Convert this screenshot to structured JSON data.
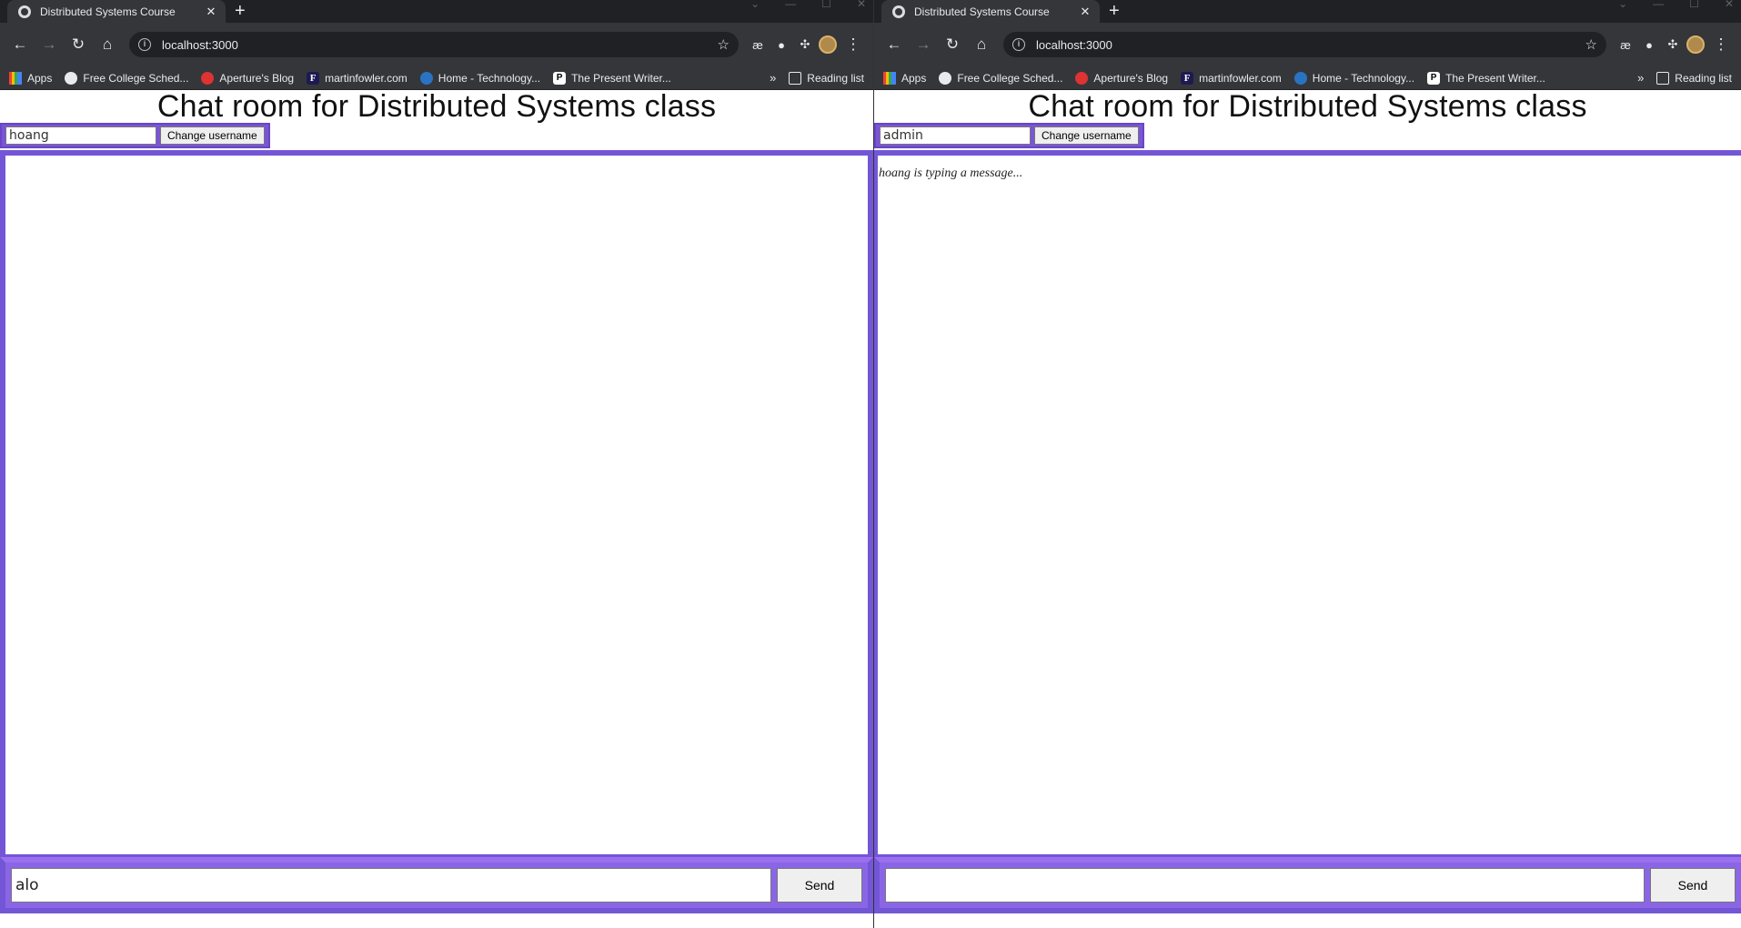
{
  "windows": [
    {
      "tab_title": "Distributed Systems Course",
      "url": "localhost:3000",
      "bookmarks": [
        "Apps",
        "Free College Sched...",
        "Aperture's Blog",
        "martinfowler.com",
        "Home - Technology...",
        "The Present Writer..."
      ],
      "bookmarks_more": "»",
      "reading_list": "Reading list",
      "heading": "Chat room for Distributed Systems class",
      "username_value": "hoang",
      "change_username_label": "Change username",
      "typing_status": "",
      "message_value": "alo",
      "send_label": "Send"
    },
    {
      "tab_title": "Distributed Systems Course",
      "url": "localhost:3000",
      "bookmarks": [
        "Apps",
        "Free College Sched...",
        "Aperture's Blog",
        "martinfowler.com",
        "Home - Technology...",
        "The Present Writer..."
      ],
      "bookmarks_more": "»",
      "reading_list": "Reading list",
      "heading": "Chat room for Distributed Systems class",
      "username_value": "admin",
      "change_username_label": "Change username",
      "typing_status": "hoang is typing a message...",
      "message_value": "",
      "send_label": "Send"
    }
  ],
  "icons": {
    "back": "arrow-left-icon",
    "forward": "arrow-right-icon",
    "reload": "reload-icon",
    "home": "home-icon",
    "bookmark_star": "star-icon",
    "extensions": "puzzle-icon",
    "menu": "kebab-menu-icon"
  },
  "colors": {
    "accent_purple": "#7356d6",
    "composer_purple": "#8a66e6",
    "chrome_dark": "#35363a",
    "tabstrip": "#202124"
  }
}
